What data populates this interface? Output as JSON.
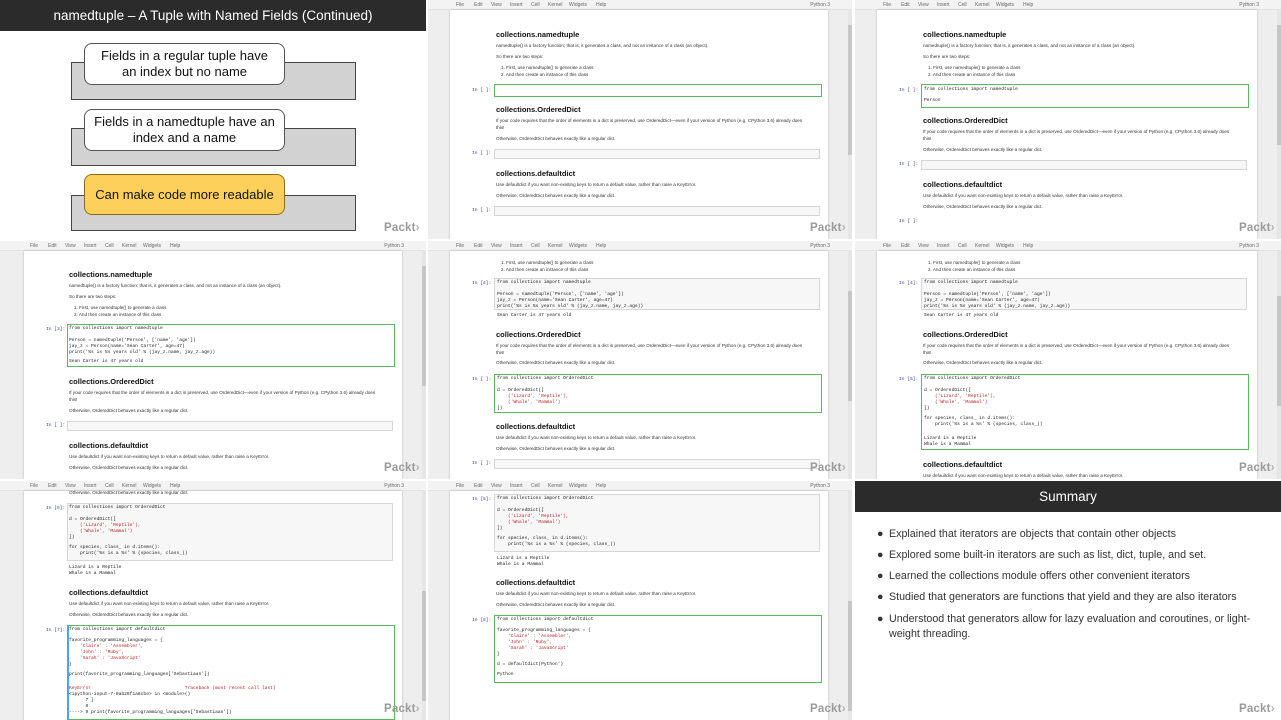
{
  "slide": {
    "title": "namedtuple – A Tuple with Named Fields (Continued)",
    "boxes": [
      "Fields in a regular tuple have an index but no name",
      "Fields in a namedtuple have an index and a name",
      "Can make code more readable"
    ]
  },
  "brand": "Packt",
  "notebook": {
    "menu": [
      "File",
      "Edit",
      "View",
      "Insert",
      "Cell",
      "Kernel",
      "Widgets",
      "Help"
    ],
    "kernel": "Python 3",
    "h_namedtuple": "collections.namedtuple",
    "p_namedtuple": "namedtuple() is a factory function; that is, it generates a class, and not an instance of a class (an object).",
    "p_two_steps": "So there are two steps:",
    "step1": "1. First, use namedtuple() to generate a class",
    "step2": "2. And then create an instance of this class",
    "h_ordered": "collections.OrderedDict",
    "p_ordered": "If your code requires that the order of elements in a dict is preserved, use OrderedDict—even if your version of Python (e.g. CPython 3.6) already does",
    "p_ordered_this": "this!",
    "p_ordered_otherwise": "Otherwise, OrderedDict behaves exactly like a regular dict.",
    "h_default": "collections.defaultdict",
    "p_default": "Use defaultdict if you want non-existing keys to return a default value, rather than raise a KeyError.",
    "p_default_otherwise": "Otherwise, OrderedDict behaves exactly like a regular dict.",
    "prompts": {
      "empty": "In [ ]:",
      "p3": "In [3]:",
      "p4": "In [4]:",
      "p5": "In [5]:",
      "p7": "In [7]:",
      "p8": "In [8]:"
    },
    "code_import_nt": "from collections import namedtuple",
    "code_person": "Person",
    "code_nt_1": "Person = namedtuple('Person', ['name', 'age'])",
    "code_nt_2": "jay_z = Person(name='Sean Carter', age=47)",
    "code_nt_3": "print('%s is %s years old' % (jay_z.name, jay_z.age))",
    "out_nt": "Sean Carter is 47 years old",
    "code_import_od": "from collections import OrderedDict",
    "code_od_1": "d = OrderedDict([",
    "code_od_2": "    ('Lizard', 'Reptile'),",
    "code_od_3": "    ('Whale', 'Mammal')",
    "code_od_4": "])",
    "code_od_5": "for species, class_ in d.items():",
    "code_od_6": "    print('%s is a %s' % (species, class_))",
    "out_od_1": "Lizard is a Reptile",
    "out_od_2": "Whale is a Mammal",
    "code_import_dd": "from collections import defaultdict",
    "code_dd_1": "favorite_programming_languages = {",
    "code_dd_2": "    'Claire' : 'Assembler',",
    "code_dd_3": "    'John' : 'Ruby',",
    "code_dd_4": "    'Sarah' : 'JavaScript'",
    "code_dd_5": "}",
    "code_dd_6": "print(favorite_programming_languages['Sebastiaan'])",
    "err_1": "KeyError                                  Traceback (most recent call last)",
    "err_2": "<ipython-input-7-0ab26f1a6cbe> in <module>()",
    "err_3": "      7 }",
    "err_4": "      8",
    "err_5": "----> 9 print(favorite_programming_languages['Sebastiaan'])",
    "code_dd_7": "d = defaultdict(Python')",
    "out_dd": "Python"
  },
  "summary": {
    "title": "Summary",
    "bullets": [
      "Explained that iterators are objects that contain other objects",
      "Explored some built-in iterators are such as list, dict, tuple, and set.",
      "Learned the collections module offers other convenient iterators",
      "Studied that generators are functions that yield and they are also iterators",
      "Understood that generators allow for lazy evaluation and coroutines, or light-weight threading."
    ]
  },
  "colors": {
    "slide_header": "#2b2b2b",
    "highlight_box": "#fcd05a",
    "active_cell": "#5cb85c",
    "prompt": "#303f9f"
  }
}
